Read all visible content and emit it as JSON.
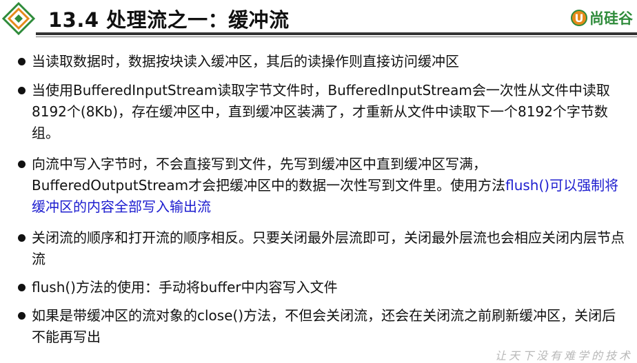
{
  "header": {
    "title": "13.4 处理流之一：缓冲流",
    "brand_mark": "U",
    "brand_name": "尚硅谷",
    "logo_colors": {
      "green": "#2e8b3a",
      "orange": "#e58a1a"
    }
  },
  "bullets": [
    {
      "text": "当读取数据时，数据按块读入缓冲区，其后的读操作则直接访问缓冲区"
    },
    {
      "text": "当使用BufferedInputStream读取字节文件时，BufferedInputStream会一次性从文件中读取8192个(8Kb)，存在缓冲区中，直到缓冲区装满了，才重新从文件中读取下一个8192个字节数组。"
    },
    {
      "text_before": "向流中写入字节时，不会直接写到文件，先写到缓冲区中直到缓冲区写满，BufferedOutputStream才会把缓冲区中的数据一次性写到文件里。使用方法",
      "text_highlight": "flush()可以强制将缓冲区的内容全部写入输出流",
      "highlight_color": "#1d1dcf"
    },
    {
      "text": "关闭流的顺序和打开流的顺序相反。只要关闭最外层流即可，关闭最外层流也会相应关闭内层节点流"
    },
    {
      "text": "flush()方法的使用：手动将buffer中内容写入文件"
    },
    {
      "text": "如果是带缓冲区的流对象的close()方法，不但会关闭流，还会在关闭流之前刷新缓冲区，关闭后不能再写出"
    }
  ],
  "footer": {
    "slogan": "让天下没有难学的技术"
  }
}
